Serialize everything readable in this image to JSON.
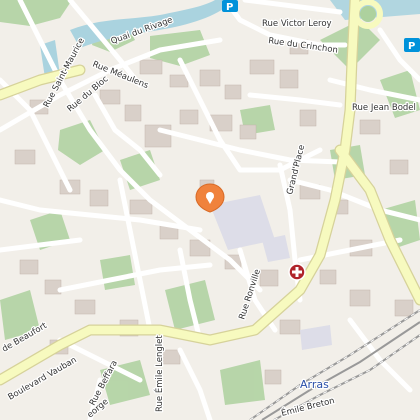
{
  "map": {
    "streets": {
      "quai_du_rivage": "Quai du Rivage",
      "rue_victor_leroy": "Rue Victor Leroy",
      "rue_du_crinchon": "Rue du Crinchon",
      "rue_meaulens": "Rue Méaulens",
      "rue_saint_maurice": "Rue Saint-Maurice",
      "rue_du_bloc": "Rue du Bloc",
      "rue_jean_bodel": "Rue Jean Bodel",
      "grand_place": "Grand'Place",
      "rue_ronville": "Rue Ronville",
      "boulevard_vauban": "Boulevard Vauban",
      "rue_de_beaufort": "de Beaufort",
      "rue_beffara": "Rue Beffara",
      "rue_emile_lenglet": "Rue Émile Lenglet",
      "rue_emile_breton": "Émile Breton",
      "george": "eorge"
    },
    "city_label": "Arras",
    "parking_symbol": "P",
    "parking_symbol_2": "P",
    "markers": {
      "location_pin": "location-pin-icon",
      "hospital": "hospital-cross-icon"
    },
    "colors": {
      "background": "#f2efe9",
      "water": "#aad3df",
      "park": "#add19e",
      "road_major": "#f7fabf",
      "road_major_casing": "#d6d29a",
      "road_minor": "#ffffff",
      "building": "#d9d0c9",
      "pedestrian": "#dddde8",
      "railway": "#999999",
      "pin": "#f0823c",
      "hospital_marker": "#b0242b",
      "parking": "#0092da"
    }
  }
}
